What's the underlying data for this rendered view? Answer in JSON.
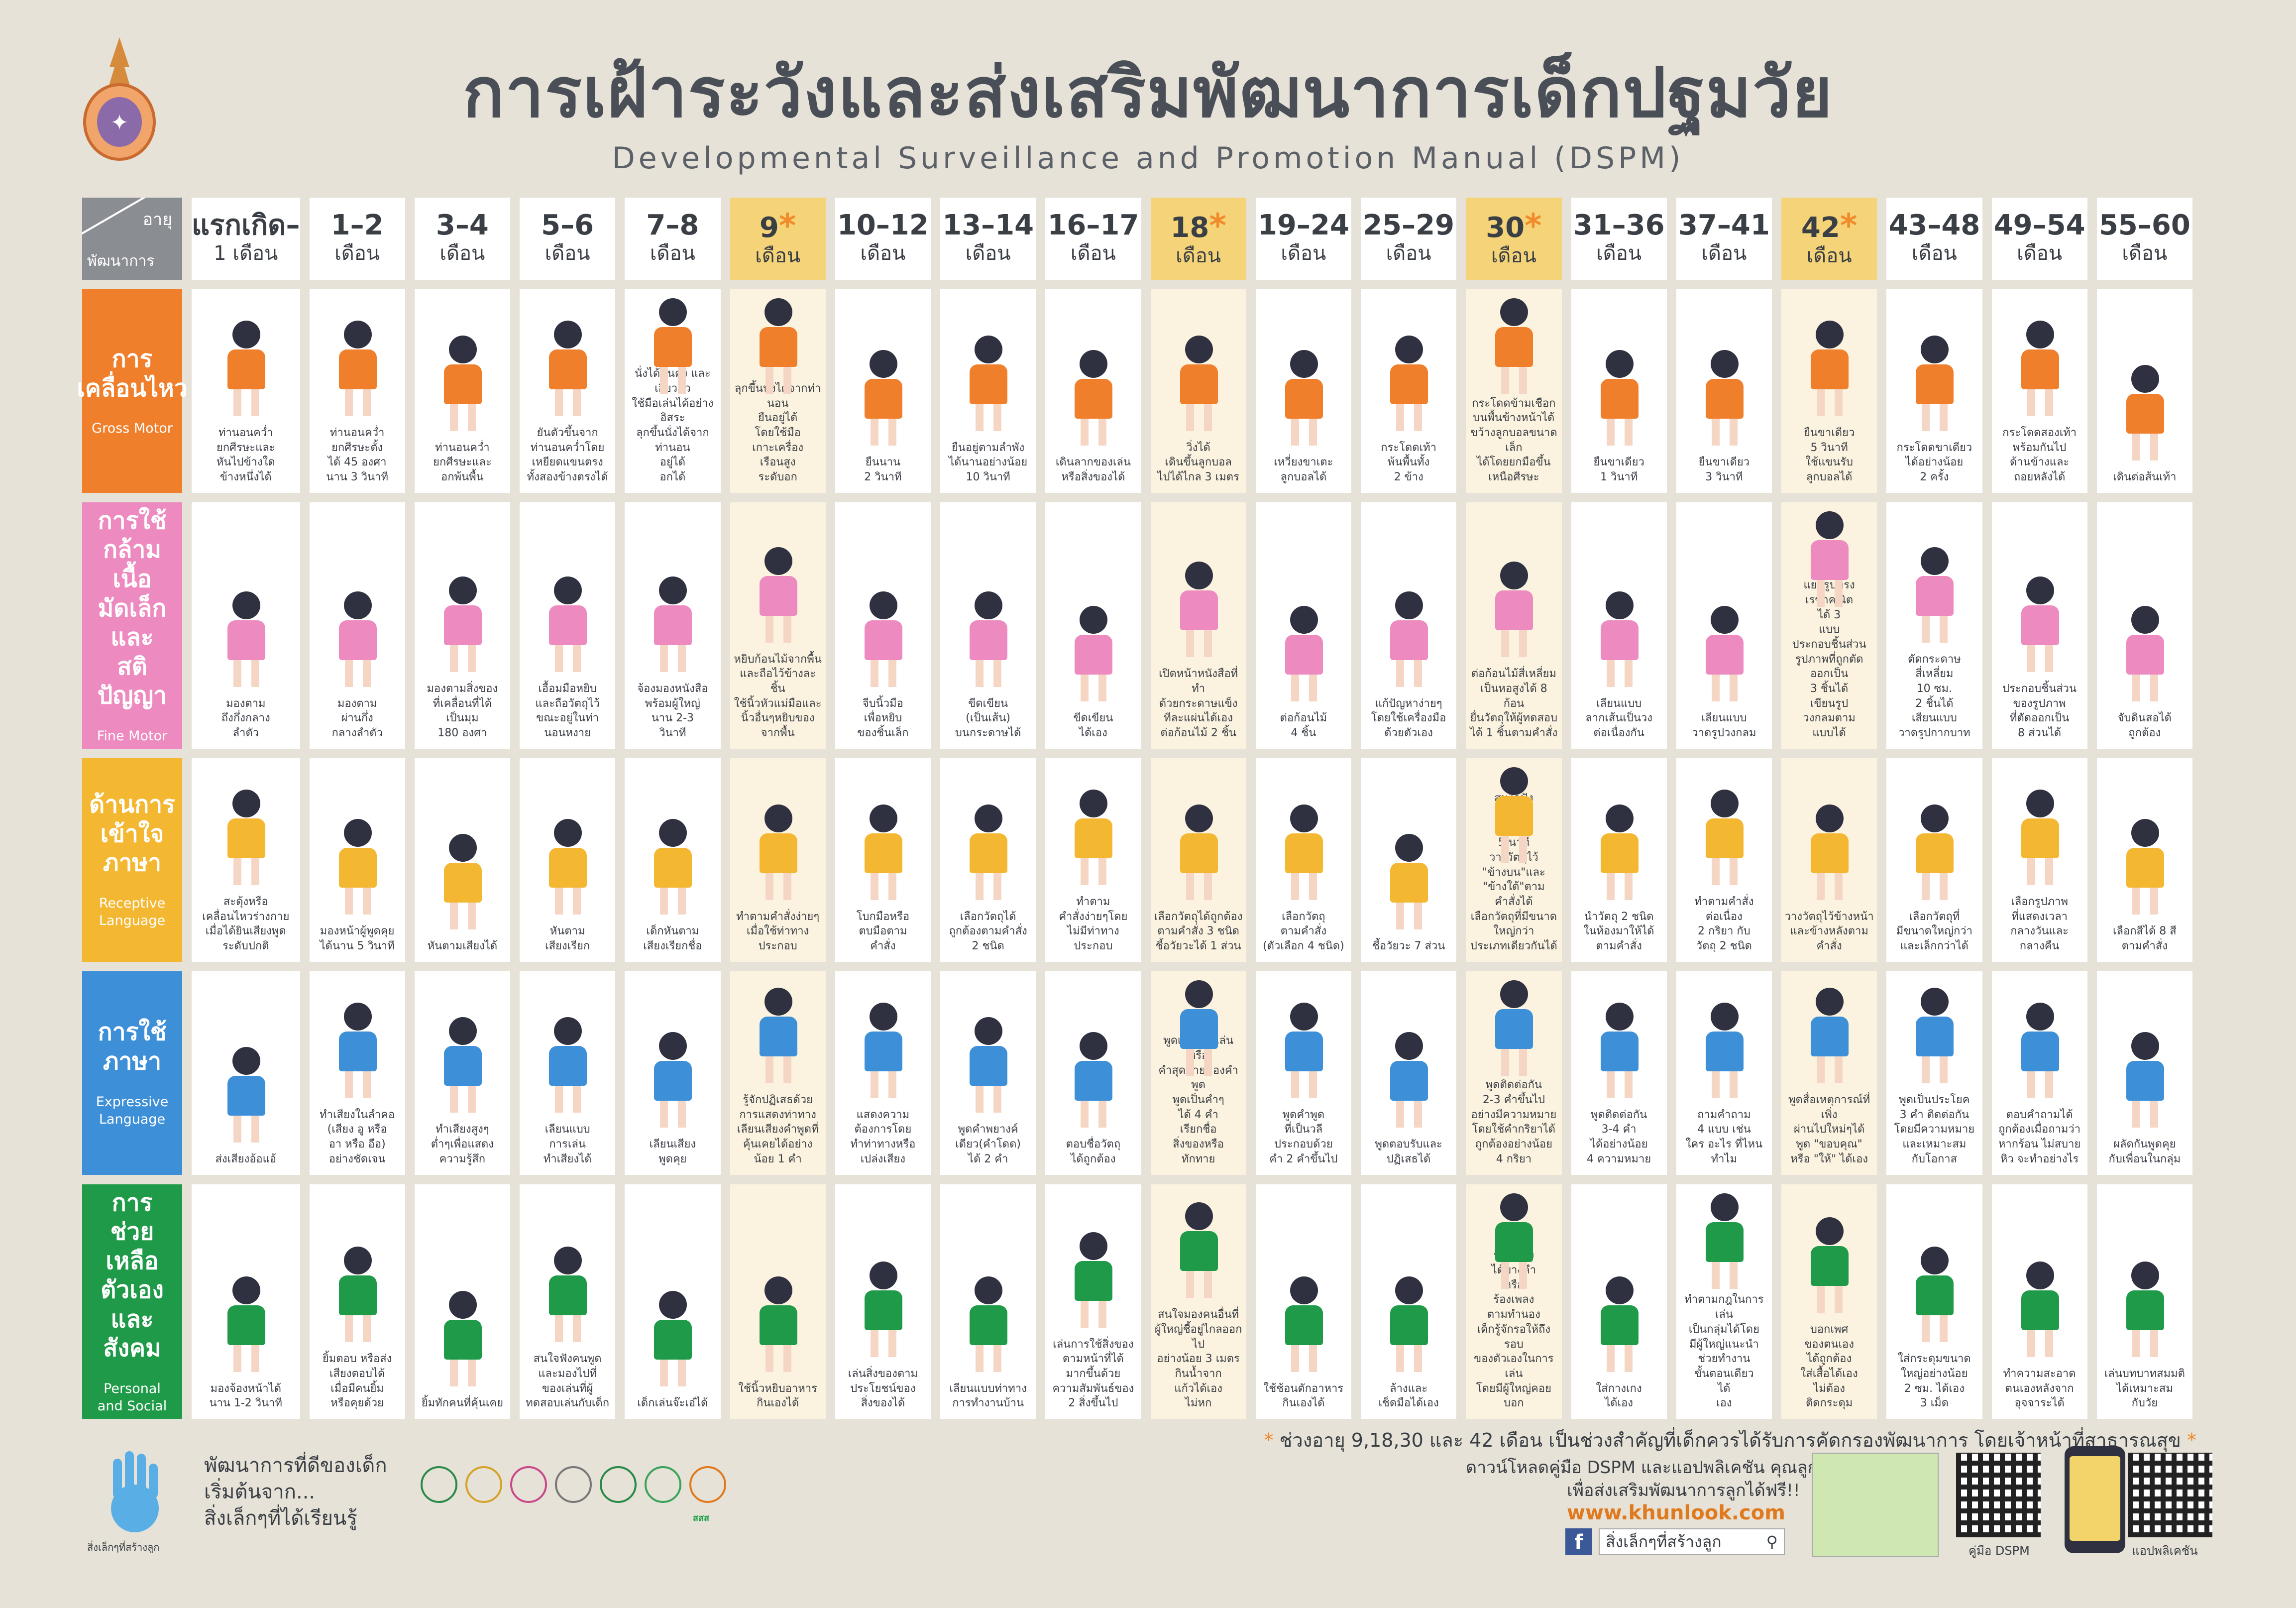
{
  "title": "การเฝ้าระวังและส่งเสริมพัฒนาการเด็กปฐมวัย",
  "subtitle": "Developmental Surveillance and Promotion Manual (DSPM)",
  "corner": {
    "age": "อายุ",
    "development": "พัฒนาการ"
  },
  "colors": {
    "gross_motor": "#f07f2c",
    "fine_motor": "#ed8ac0",
    "receptive": "#f4b731",
    "expressive": "#3d8fd8",
    "personal": "#1f9a48",
    "key_header": "#f5d479",
    "key_column": "#fbf3df",
    "star": "#f08a2a",
    "background": "#e6e2d7"
  },
  "ages": [
    {
      "top": "แรกเกิด–",
      "bottom": "1 เดือน",
      "key": false
    },
    {
      "top": "1–2",
      "bottom": "เดือน",
      "key": false
    },
    {
      "top": "3–4",
      "bottom": "เดือน",
      "key": false
    },
    {
      "top": "5–6",
      "bottom": "เดือน",
      "key": false
    },
    {
      "top": "7–8",
      "bottom": "เดือน",
      "key": false
    },
    {
      "top": "9",
      "bottom": "เดือน",
      "key": true
    },
    {
      "top": "10–12",
      "bottom": "เดือน",
      "key": false
    },
    {
      "top": "13–14",
      "bottom": "เดือน",
      "key": false
    },
    {
      "top": "16–17",
      "bottom": "เดือน",
      "key": false
    },
    {
      "top": "18",
      "bottom": "เดือน",
      "key": true
    },
    {
      "top": "19–24",
      "bottom": "เดือน",
      "key": false
    },
    {
      "top": "25–29",
      "bottom": "เดือน",
      "key": false
    },
    {
      "top": "30",
      "bottom": "เดือน",
      "key": true
    },
    {
      "top": "31–36",
      "bottom": "เดือน",
      "key": false
    },
    {
      "top": "37–41",
      "bottom": "เดือน",
      "key": false
    },
    {
      "top": "42",
      "bottom": "เดือน",
      "key": true
    },
    {
      "top": "43–48",
      "bottom": "เดือน",
      "key": false
    },
    {
      "top": "49–54",
      "bottom": "เดือน",
      "key": false
    },
    {
      "top": "55–60",
      "bottom": "เดือน",
      "key": false
    }
  ],
  "star_mark": "*",
  "categories": [
    {
      "th": "การ\nเคลื่อนไหว",
      "en": "Gross Motor",
      "color_key": "gross_motor",
      "items": [
        "ท่านอนคว่ำ\nยกศีรษะและ\nหันไปข้างใด\nข้างหนึ่งได้",
        "ท่านอนคว่ำ\nยกศีรษะตั้ง\nได้ 45 องศา\nนาน 3 วินาที",
        "ท่านอนคว่ำ\nยกศีรษะและ\nอกพ้นพื้น",
        "ยันตัวขึ้นจาก\nท่านอนคว่ำโดย\nเหยียดแขนตรง\nทั้งสองข้างตรงได้",
        "นั่งได้มั่นคง และเอี้ยวตัว\nใช้มือเล่นได้อย่างอิสระ\nลุกขึ้นนั่งได้จาก\nท่านอน\nอยู่ได้\nอกได้",
        "ลุกขึ้นนั่งได้จากท่านอน\nยืนอยู่ได้\nโดยใช้มือ\nเกาะเครื่อง\nเรือนสูง\nระดับอก",
        "ยืนนาน\n2 วินาที",
        "ยืนอยู่ตามลำพัง\nได้นานอย่างน้อย\n10 วินาที",
        "เดินลากของเล่น\nหรือสิ่งของได้",
        "วิ่งได้\nเดินขึ้นลูกบอล\nไปได้ไกล 3 เมตร",
        "เหวี่ยงขาเตะ\nลูกบอลได้",
        "กระโดดเท้า\nพ้นพื้นทั้ง\n2 ข้าง",
        "กระโดดข้ามเชือก\nบนพื้นข้างหน้าได้\nขว้างลูกบอลขนาดเล็ก\nได้โดยยกมือขึ้น\nเหนือศีรษะ",
        "ยืนขาเดียว\n1 วินาที",
        "ยืนขาเดียว\n3 วินาที",
        "ยืนขาเดียว\n5 วินาที\nใช้แขนรับ\nลูกบอลได้",
        "กระโดดขาเดียว\nได้อย่างน้อย\n2 ครั้ง",
        "กระโดดสองเท้า\nพร้อมกันไป\nด้านข้างและ\nถอยหลังได้",
        "เดินต่อส้นเท้า"
      ]
    },
    {
      "th": "การใช้\nกล้ามเนื้อ\nมัดเล็ก\nและ\nสติปัญญา",
      "en": "Fine Motor",
      "color_key": "fine_motor",
      "items": [
        "มองตาม\nถึงกึ่งกลาง\nลำตัว",
        "มองตาม\nผ่านกึ่ง\nกลางลำตัว",
        "มองตามสิ่งของ\nที่เคลื่อนที่ได้\nเป็นมุม\n180 องศา",
        "เอื้อมมือหยิบ\nและถือวัตถุไว้\nขณะอยู่ในท่า\nนอนหงาย",
        "จ้องมองหนังสือ\nพร้อมผู้ใหญ่\nนาน 2-3\nวินาที",
        "หยิบก้อนไม้จากพื้น\nและถือไว้ข้างละชิ้น\nใช้นิ้วหัวแม่มือและ\nนิ้วอื่นๆหยิบของจากพื้น",
        "จีบนิ้วมือ\nเพื่อหยิบ\nของชิ้นเล็ก",
        "ขีดเขียน\n(เป็นเส้น)\nบนกระดาษได้",
        "ขีดเขียน\nได้เอง",
        "เปิดหน้าหนังสือที่ทำ\nด้วยกระดาษแข็ง\nทีละแผ่นได้เอง\nต่อก้อนไม้ 2 ชิ้น",
        "ต่อก้อนไม้\n4 ชิ้น",
        "แก้ปัญหาง่ายๆ\nโดยใช้เครื่องมือ\nด้วยตัวเอง",
        "ต่อก้อนไม้สี่เหลี่ยม\nเป็นหอสูงได้ 8 ก้อน\nยื่นวัตถุให้ผู้ทดสอบ\nได้ 1 ชิ้นตามคำสั่ง",
        "เลียนแบบ\nลากเส้นเป็นวง\nต่อเนื่องกัน",
        "เลียนแบบ\nวาดรูปวงกลม",
        "แยกรูปทรง\nเรขาคณิต\nได้ 3\nแบบ\nประกอบชิ้นส่วน\nรูปภาพที่ถูกตัด\nออกเป็น\n3 ชิ้นได้\nเขียนรูป\nวงกลมตาม\nแบบได้",
        "ตัดกระดาษ\nสี่เหลี่ยม\n10 ซม.\n2 ชิ้นได้\nเสียนแบบ\nวาดรูปกากบาท",
        "ประกอบชิ้นส่วน\nของรูปภาพ\nที่ตัดออกเป็น\n8 ส่วนได้",
        "จับดินสอได้\nถูกต้อง"
      ]
    },
    {
      "th": "ด้านการ\nเข้าใจ\nภาษา",
      "en": "Receptive\nLanguage",
      "color_key": "receptive",
      "items": [
        "สะดุ้งหรือ\nเคลื่อนไหวร่างกาย\nเมื่อได้ยินเสียงพูด\nระดับปกติ",
        "มองหน้าผู้พูดคุย\nได้นาน 5 วินาที",
        "หันตามเสียงได้",
        "หันตาม\nเสียงเรียก",
        "เด็กหันตาม\nเสียงเรียกชื่อ",
        "ทำตามคำสั่งง่ายๆ\nเมื่อใช้ท่าทาง\nประกอบ",
        "โบกมือหรือ\nตบมือตาม\nคำสั่ง",
        "เลือกวัตถุได้\nถูกต้องตามคำสั่ง\n2 ชนิด",
        "ทำตาม\nคำสั่งง่ายๆโดย\nไม่มีท่าทางประกอบ",
        "เลือกวัตถุได้ถูกต้อง\nตามคำสั่ง 3 ชนิด\nชี้อวัยวะได้ 1 ส่วน",
        "เลือกวัตถุ\nตามคำสั่ง\n(ตัวเลือก 4 ชนิด)",
        "ชี้อวัยวะ 7 ส่วน",
        "สนใจฟัง\nนิทาน\nได้นาน\n5 นาที\nวางวัตถุไว้\n\"ข้างบน\"และ\n\"ข้างใต้\"ตาม\nคำสั่งได้\nเลือกวัตถุที่มีขนาดใหญ่กว่า\nประเภทเดียวกันได้",
        "นำวัตถุ 2 ชนิด\nในห้องมาให้ได้\nตามคำสั่ง",
        "ทำตามคำสั่ง\nต่อเนื่อง\n2 กริยา กับ\nวัตถุ 2 ชนิด",
        "วางวัตถุไว้ข้างหน้า\nและข้างหลังตามคำสั่ง",
        "เลือกวัตถุที่\nมีขนาดใหญ่กว่า\nและเล็กกว่าได้",
        "เลือกรูปภาพ\nที่แสดงเวลา\nกลางวันและ\nกลางคืน",
        "เลือกสีได้ 8 สี\nตามคำสั่ง"
      ]
    },
    {
      "th": "การใช้\nภาษา",
      "en": "Expressive\nLanguage",
      "color_key": "expressive",
      "items": [
        "ส่งเสียงอ้อแอ้",
        "ทำเสียงในลำคอ\n(เสียง อู หรือ\nอา หรือ อือ)\nอย่างชัดเจน",
        "ทำเสียงสูงๆ\nต่ำๆเพื่อแสดง\nความรู้สึก",
        "เลียนแบบ\nการเล่น\nทำเสียงได้",
        "เลียนเสียง\nพูดคุย",
        "รู้จักปฏิเสธด้วย\nการแสดงท่าทาง\nเลียนเสียงคำพูดที่คุ้นเคยได้อย่างน้อย 1 คำ",
        "แสดงความ\nต้องการโดย\nทำท่าทางหรือ\nเปล่งเสียง",
        "พูดคำพยางค์\nเดียว(คำโดด)\nได้ 2 คำ",
        "ตอบชื่อวัตถุ\nได้ถูกต้อง",
        "พูดเลียนคำเล่นหรือ\nคำสุดท้ายของคำพูด\nพูดเป็นคำๆ\nได้ 4 คำ\nเรียกชื่อ\nสิ่งของหรือ\nทักทาย",
        "พูดคำพูด\nที่เป็นวลี\nประกอบด้วย\nคำ 2 คำขึ้นไป",
        "พูดตอบรับและ\nปฏิเสธได้",
        "พูดติดต่อกัน\n2-3 คำขึ้นไป\nอย่างมีความหมาย\nโดยใช้คำกริยาได้\nถูกต้องอย่างน้อย\n4 กริยา",
        "พูดติดต่อกัน\n3-4 คำ\nได้อย่างน้อย\n4 ความหมาย",
        "ถามคำถาม\n4 แบบ เช่น\nใคร อะไร ที่ไหน\nทำไม",
        "พูดสื่อเหตุการณ์ที่เพิ่ง\nผ่านไปใหม่ๆได้\nพูด \"ขอบคุณ\"\nหรือ \"ให้\" ได้เอง",
        "พูดเป็นประโยค\n3 คำ ติดต่อกัน\nโดยมีความหมาย\nและเหมาะสม\nกับโอกาส",
        "ตอบคำถามได้\nถูกต้องเมื่อถามว่า\nหากร้อน ไม่สบาย\nหิว จะทำอย่างไร",
        "ผลัดกันพูดคุย\nกับเพื่อนในกลุ่ม"
      ]
    },
    {
      "th": "การ\nช่วยเหลือ\nตัวเอง\nและสังคม",
      "en": "Personal\nand Social",
      "color_key": "personal",
      "items": [
        "มองจ้องหน้าได้\nนาน 1-2 วินาที",
        "ยิ้มตอบ หรือส่ง\nเสียงตอบได้\nเมื่อมีคนยิ้ม\nหรือคุยด้วย",
        "ยิ้มทักคนที่คุ้นเคย",
        "สนใจฟังคนพูด\nและมองไปที่\nของเล่นที่ผู้\nทดสอบเล่นกับเด็ก",
        "เด็กเล่นจ๊ะเอ๋ได้",
        "ใช้นิ้วหยิบอาหาร\nกินเองได้",
        "เล่นสิ่งของตาม\nประโยชน์ของ\nสิ่งของได้",
        "เลียนแบบท่าทาง\nการทำงานบ้าน",
        "เล่นการใช้สิ่งของ\nตามหน้าที่ได้\nมากขึ้นด้วย\nความสัมพันธ์ของ\n2 สิ่งขึ้นไป",
        "สนใจมองคนอื่นที่\nผู้ใหญ่ชี้อยู่ไกลออกไป\nอย่างน้อย 3 เมตร\nกินน้ำจาก\nแก้วได้เอง\nไม่หก",
        "ใช้ช้อนตักอาหาร\nกินเองได้",
        "ล้างและ\nเช็ดมือได้เอง",
        "ร้องเพลง\nได้บางคำ\nหรือ\nร้องเพลง\nตามทำนอง\nเด็กรู้จักรอให้ถึงรอบ\nของตัวเองในการเล่น\nโดยมีผู้ใหญ่คอยบอก",
        "ใส่กางเกง\nได้เอง",
        "ทำตามกฎในการเล่น\nเป็นกลุ่มได้โดย\nมีผู้ใหญ่แนะนำ\nช่วยทำงาน\nขั้นตอนเดียว\nได้\nเอง",
        "บอกเพศ\nของตนเอง\nได้ถูกต้อง\nใส่เสื้อได้เอง\nไม่ต้อง\nติดกระดุม",
        "ใส่กระดุมขนาด\nใหญ่อย่างน้อย\n2 ซม. ได้เอง\n3 เม็ด",
        "ทำความสะอาด\nตนเองหลังจาก\nอุจจาระได้",
        "เล่นบทบาทสมมติ\nได้เหมาะสม\nกับวัย"
      ]
    }
  ],
  "footnote": "ช่วงอายุ 9,18,30 และ 42 เดือน เป็นช่วงสำคัญที่เด็กควรได้รับการคัดกรองพัฒนาการ โดยเจ้าหน้าที่สาธารณสุข",
  "hand_caption": "สิ่งเล็กๆที่สร้างลูก",
  "slogan": "พัฒนาการที่ดีของเด็ก\nเริ่มต้นจาก...\nสิ่งเล็กๆที่ได้เรียนรู้",
  "sponsor_label": "สสส",
  "download_line1": "ดาวน์โหลดคู่มือ DSPM และแอปพลิเคชัน คุณลูก",
  "download_line2": "เพื่อส่งเสริมพัฒนาการลูกได้ฟรี!!",
  "website": "www.khunlook.com",
  "facebook_icon": "f",
  "facebook_text": "สิ่งเล็กๆที่สร้างลูก",
  "qr_dspm_caption": "คู่มือ DSPM",
  "qr_app_caption": "แอปพลิเคชัน"
}
